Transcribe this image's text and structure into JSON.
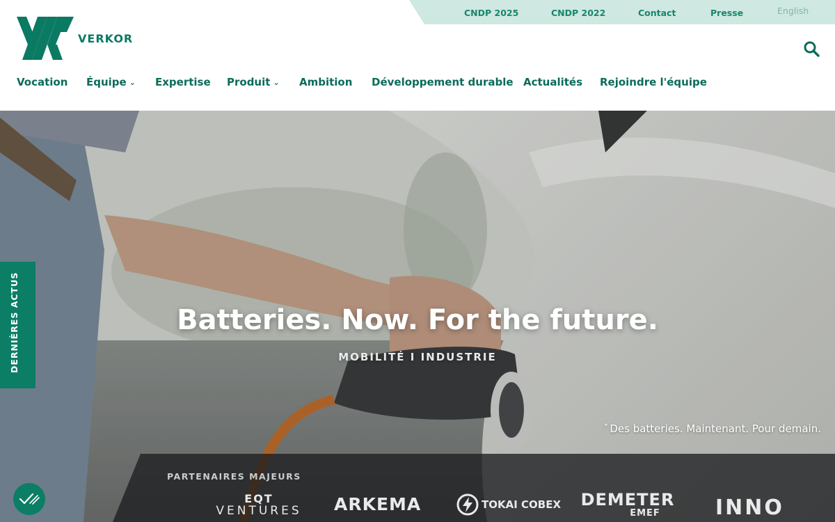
{
  "brand": {
    "name": "VERKOR",
    "color": "#0b7a62"
  },
  "topbar": {
    "links": [
      "CNDP 2025",
      "CNDP 2022",
      "Contact",
      "Presse"
    ],
    "language": "English"
  },
  "nav": {
    "items": [
      {
        "label": "Vocation",
        "dropdown": false
      },
      {
        "label": "Équipe",
        "dropdown": true
      },
      {
        "label": "Expertise",
        "dropdown": false
      },
      {
        "label": "Produit",
        "dropdown": true
      },
      {
        "label": "Ambition",
        "dropdown": false
      },
      {
        "label": "Développement durable",
        "dropdown": false
      },
      {
        "label": "Actualités",
        "dropdown": false
      },
      {
        "label": "Rejoindre l'équipe",
        "dropdown": false
      }
    ],
    "chevron": "❯"
  },
  "hero": {
    "title": "Batteries. Now. For the future.",
    "subtitle": "MOBILITÉ I INDUSTRIE",
    "note_mark": "*",
    "note": "Des batteries. Maintenant. Pour demain."
  },
  "sidebar_tab": {
    "label": "DERNIÈRES ACTUS"
  },
  "partners": {
    "label": "PARTENAIRES MAJEURS",
    "logos": [
      {
        "line1": "EQT",
        "line2": "VENTURES"
      },
      {
        "line1": "ARKEMA"
      },
      {
        "line1": "TOKAI COBEX"
      },
      {
        "line1": "DEMETER",
        "line2": "EMEF"
      },
      {
        "line1": "INNO"
      }
    ]
  },
  "icons": {
    "search": "search-icon",
    "cookie": "check-icon"
  },
  "colors": {
    "primary": "#0c7e66",
    "topbar_bg": "#cfe8e1",
    "text": "#0b6b5a"
  }
}
